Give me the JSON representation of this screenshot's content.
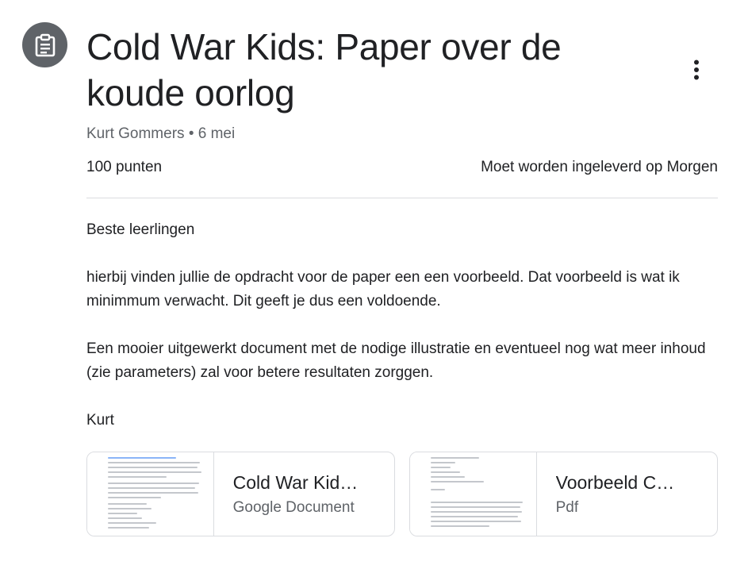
{
  "assignment": {
    "icon": "assignment-icon",
    "title": "Cold War Kids: Paper over de koude oorlog",
    "author": "Kurt Gommers",
    "separator": "•",
    "date": "6 mei",
    "points": "100 punten",
    "due": "Moet worden ingeleverd op Morgen",
    "more_icon": "more-vert-icon"
  },
  "body": {
    "paragraphs": [
      "Beste leerlingen",
      "hierbij vinden jullie de opdracht voor de paper een een voorbeeld. Dat voorbeeld is wat ik minimmum verwacht. Dit geeft je dus een voldoende.",
      "Een mooier uitgewerkt document met de nodige illustratie en eventueel nog wat meer inhoud (zie parameters) zal voor betere resultaten zorggen.",
      "Kurt"
    ]
  },
  "attachments": [
    {
      "title": "Cold War Kid…",
      "type": "Google Document"
    },
    {
      "title": "Voorbeeld C…",
      "type": "Pdf"
    }
  ],
  "colors": {
    "icon_bg": "#5f6368",
    "text": "#202124",
    "muted": "#5f6368",
    "divider": "#dadce0"
  }
}
